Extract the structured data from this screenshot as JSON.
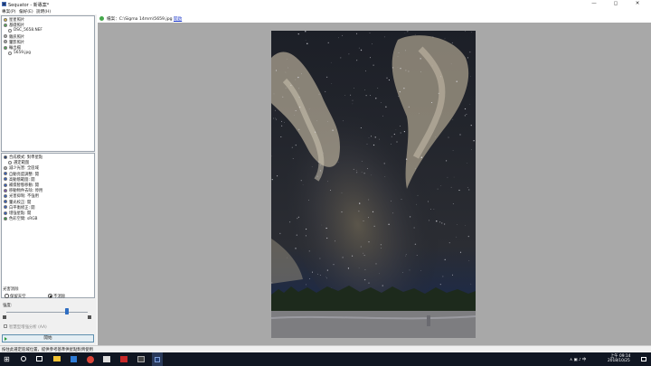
{
  "window": {
    "title": "Sequator - 新專案*",
    "minimize_symbol": "—",
    "maximize_symbol": "◻",
    "close_symbol": "✕"
  },
  "menu": [
    "專案(P)",
    "偏好(E)",
    "說明(H)"
  ],
  "tree_images": [
    {
      "label": "星星照片",
      "icon": "image-icon",
      "color": "#e8c13a",
      "indent": 0
    },
    {
      "label": "基礎照片",
      "icon": "image-icon",
      "color": "#4caf50",
      "indent": 0
    },
    {
      "label": "DSC_5658.NEF",
      "icon": "file-icon",
      "color": "#ffffff",
      "indent": 1
    },
    {
      "label": "雜訊照片",
      "icon": "noise-icon",
      "color": "#b0b0b0",
      "indent": 0
    },
    {
      "label": "暈影照片",
      "icon": "vignette-icon",
      "color": "#b0b0b0",
      "indent": 0
    },
    {
      "label": "輸出檔",
      "icon": "output-icon",
      "color": "#4caf50",
      "indent": 0
    },
    {
      "label": "5659.jpg",
      "icon": "file-icon",
      "color": "#ffffff",
      "indent": 1
    }
  ],
  "tree_settings": [
    {
      "label": "合成模式: 對準星點",
      "icon": "mode-icon",
      "color": "#1f3b73",
      "indent": 0
    },
    {
      "label": "選定範圍",
      "icon": "range-icon",
      "color": "#ffffff",
      "indent": 1
    },
    {
      "label": "減少光害: 全區域",
      "icon": "light-pollution-icon",
      "color": "#b0b0b0",
      "indent": 0
    },
    {
      "label": "自動亮度調整: 開",
      "icon": "brightness-icon",
      "color": "#2b5cc8",
      "indent": 0
    },
    {
      "label": "高動態範圍: 開",
      "icon": "hdr-icon",
      "color": "#2b5cc8",
      "indent": 0
    },
    {
      "label": "補償暫態移動: 開",
      "icon": "motion-icon",
      "color": "#2b5cc8",
      "indent": 0
    },
    {
      "label": "移動物件去除: 停用",
      "icon": "object-removal-icon",
      "color": "#7a4fb5",
      "indent": 0
    },
    {
      "label": "光害抑制: 不強用",
      "icon": "suppress-icon",
      "color": "#2b5cc8",
      "indent": 0
    },
    {
      "label": "暈光校正: 開",
      "icon": "vignette-correction-icon",
      "color": "#2b5cc8",
      "indent": 0
    },
    {
      "label": "白平衡修正: 開",
      "icon": "white-balance-icon",
      "color": "#2b5cc8",
      "indent": 0
    },
    {
      "label": "增強星點: 開",
      "icon": "star-enhance-icon",
      "color": "#2b5cc8",
      "indent": 0
    },
    {
      "label": "色彩空間: sRGB",
      "icon": "color-space-icon",
      "color": "#2b9b3a",
      "indent": 0
    }
  ],
  "options": {
    "group_label": "光害消除",
    "radio_a": "保留天空",
    "radio_b": "不消除",
    "strength_label": "強度:",
    "slider_value": 0.74,
    "checkbox_label": "智慧型增強分析 (AA)",
    "start_button": "開始"
  },
  "path": {
    "text": "檔案：C:\\Sigma 14mm\\5659.jpg",
    "link": "開啟"
  },
  "status": "按住此選定區域位置，提供參考基準供星點對齊使用",
  "taskbar": {
    "time": "上午 09:14",
    "date": "2018/10/25"
  }
}
